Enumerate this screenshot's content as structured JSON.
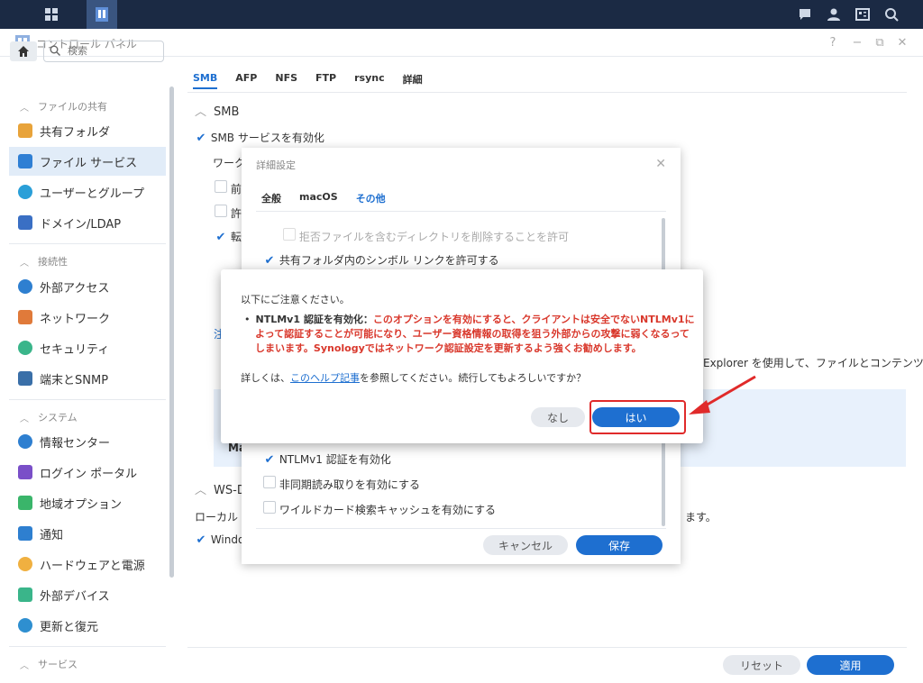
{
  "window": {
    "title": "コントロール パネル"
  },
  "sidebar": {
    "search_placeholder": "検索",
    "sections": [
      {
        "label": "ファイルの共有",
        "items": [
          {
            "label": "共有フォルダ",
            "icon": "folder-share-icon",
            "color": "#e8a33a"
          },
          {
            "label": "ファイル サービス",
            "icon": "file-services-icon",
            "color": "#2f7fd4",
            "active": true
          },
          {
            "label": "ユーザーとグループ",
            "icon": "users-icon",
            "color": "#2a9fd8"
          },
          {
            "label": "ドメイン/LDAP",
            "icon": "domain-icon",
            "color": "#3a6fc4"
          }
        ]
      },
      {
        "label": "接続性",
        "items": [
          {
            "label": "外部アクセス",
            "icon": "external-access-icon",
            "color": "#2e7fd0"
          },
          {
            "label": "ネットワーク",
            "icon": "network-icon",
            "color": "#e07a3a"
          },
          {
            "label": "セキュリティ",
            "icon": "security-icon",
            "color": "#3ab58a"
          },
          {
            "label": "端末とSNMP",
            "icon": "terminal-icon",
            "color": "#3a6fa8"
          }
        ]
      },
      {
        "label": "システム",
        "items": [
          {
            "label": "情報センター",
            "icon": "info-icon",
            "color": "#2e7fd0"
          },
          {
            "label": "ログイン ポータル",
            "icon": "login-portal-icon",
            "color": "#7a4fc8"
          },
          {
            "label": "地域オプション",
            "icon": "regional-icon",
            "color": "#3ab56a"
          },
          {
            "label": "通知",
            "icon": "notification-icon",
            "color": "#2e7fd0"
          },
          {
            "label": "ハードウェアと電源",
            "icon": "hardware-icon",
            "color": "#f0b040"
          },
          {
            "label": "外部デバイス",
            "icon": "external-device-icon",
            "color": "#3ab58a"
          },
          {
            "label": "更新と復元",
            "icon": "update-icon",
            "color": "#2e8fd0"
          }
        ]
      },
      {
        "label": "サービス",
        "items": []
      }
    ]
  },
  "main": {
    "tabs": [
      "SMB",
      "AFP",
      "NFS",
      "FTP",
      "rsync",
      "詳細"
    ],
    "smb_section": "SMB",
    "enable_smb": "SMB サービスを有効化",
    "workgroup_partial": "ワーク",
    "opt1_partial": "前",
    "opt2_partial": "許",
    "opt3_partial": "転",
    "note_partial": "注",
    "explorer_text": "Explorer を使用して、ファイルとコンテンツを",
    "box_partial": "Ma",
    "wsd_section": "WS-D",
    "local_partial": "ローカル ネ",
    "local_right": "ます。",
    "windows_partial": "Windo",
    "reset_label": "リセット",
    "apply_label": "適用"
  },
  "dialog": {
    "title": "詳細設定",
    "tabs": [
      "全般",
      "macOS",
      "その他"
    ],
    "item_deny_delete": "拒否ファイルを含むディレクトリを削除することを許可",
    "item_symlink": "共有フォルダ内のシンボル リンクを許可する",
    "item_ntlmv1": "NTLMv1 認証を有効化",
    "item_async": "非同期読み取りを有効にする",
    "item_wildcard": "ワイルドカード検索キャッシュを有効にする",
    "cancel_label": "キャンセル",
    "save_label": "保存"
  },
  "alert": {
    "heading": "以下にご注意ください。",
    "bullet_bold": "NTLMv1 認証を有効化：",
    "bullet_red_1": "このオプションを有効にすると、クライアントは安全でないNTLMv1に",
    "bullet_red_2": "よって認証することが可能になり、ユーザー資格情報の取得を狙う外部からの攻撃に弱くなるって",
    "bullet_red_3": "しまいます。Synologyではネットワーク認証設定を更新するよう強くお勧めします。",
    "detail_prefix": "詳しくは、",
    "help_link": "このヘルプ記事",
    "detail_suffix": "を参照してください。続行してもよろしいですか？",
    "no_label": "なし",
    "yes_label": "はい"
  },
  "colors": {
    "accent": "#1e6fd0",
    "warning": "#d9382c",
    "annotation": "#e02a2a"
  }
}
